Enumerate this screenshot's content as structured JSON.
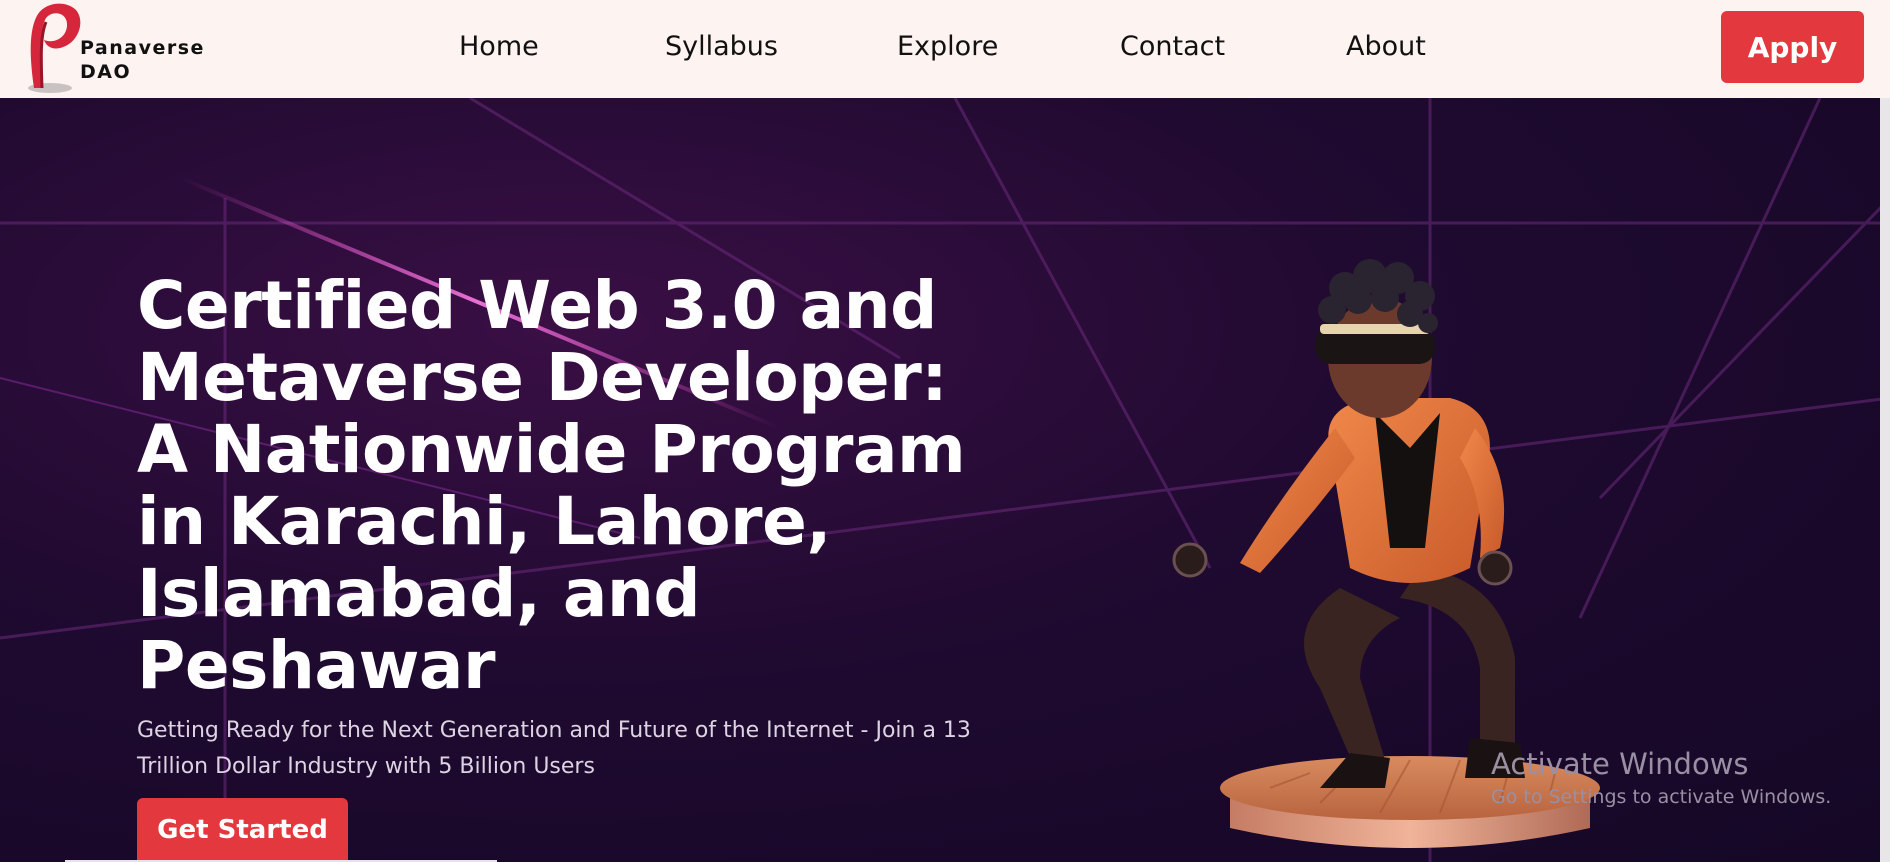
{
  "brand": {
    "line1": "Panaverse",
    "line2": "DAO",
    "accent": "#e3383e",
    "icon": "panaverse-logo-icon"
  },
  "nav": {
    "items": [
      {
        "label": "Home"
      },
      {
        "label": "Syllabus"
      },
      {
        "label": "Explore"
      },
      {
        "label": "Contact"
      },
      {
        "label": "About"
      }
    ],
    "apply_label": "Apply"
  },
  "hero": {
    "title": "Certified Web 3.0 and Metaverse Developer: A Nationwide Program in Karachi, Lahore, Islamabad, and Peshawar",
    "subtitle": "Getting Ready for the Next Generation and Future of the Internet - Join a 13 Trillion Dollar Industry with 5 Billion Users",
    "cta_label": "Get Started",
    "background": "#1a0a2a"
  },
  "watermark": {
    "title": "Activate Windows",
    "subtitle": "Go to Settings to activate Windows."
  }
}
